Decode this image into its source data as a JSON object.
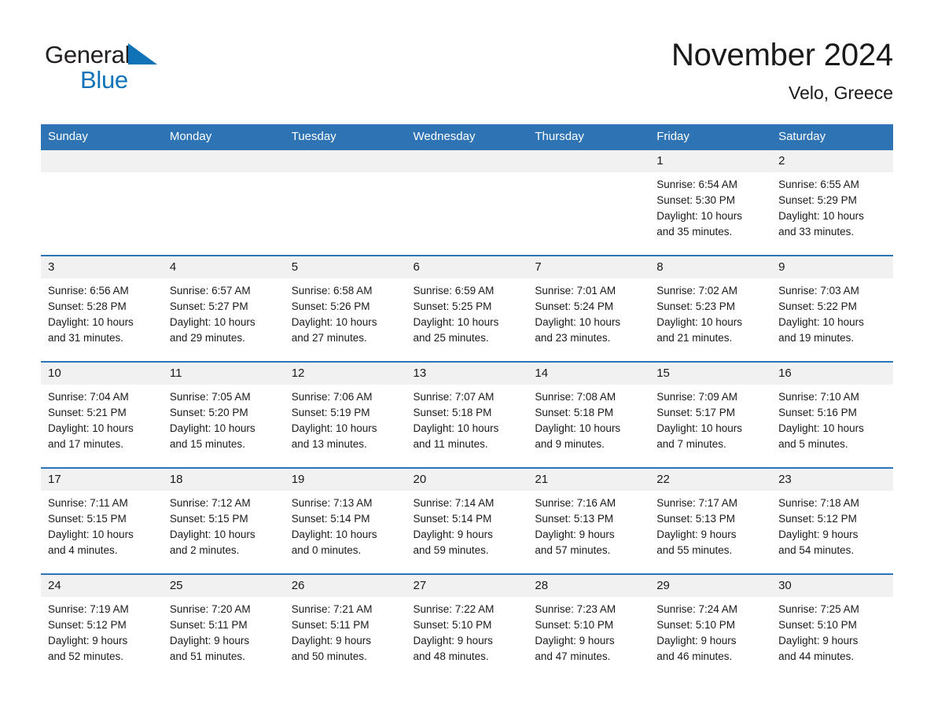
{
  "logo": {
    "word1": "General",
    "word2": "Blue",
    "triangle_color": "#1073b8",
    "text_color": "#231f20"
  },
  "header": {
    "title": "November 2024",
    "subtitle": "Velo, Greece"
  },
  "theme": {
    "header_blue": "#2e74b5",
    "daynum_gray": "#f1f1f1",
    "text": "#1a1a1a"
  },
  "weekday_headers": [
    "Sunday",
    "Monday",
    "Tuesday",
    "Wednesday",
    "Thursday",
    "Friday",
    "Saturday"
  ],
  "weeks": [
    [
      {
        "day": "",
        "sunrise": "",
        "sunset": "",
        "daylight1": "",
        "daylight2": ""
      },
      {
        "day": "",
        "sunrise": "",
        "sunset": "",
        "daylight1": "",
        "daylight2": ""
      },
      {
        "day": "",
        "sunrise": "",
        "sunset": "",
        "daylight1": "",
        "daylight2": ""
      },
      {
        "day": "",
        "sunrise": "",
        "sunset": "",
        "daylight1": "",
        "daylight2": ""
      },
      {
        "day": "",
        "sunrise": "",
        "sunset": "",
        "daylight1": "",
        "daylight2": ""
      },
      {
        "day": "1",
        "sunrise": "Sunrise: 6:54 AM",
        "sunset": "Sunset: 5:30 PM",
        "daylight1": "Daylight: 10 hours",
        "daylight2": "and 35 minutes."
      },
      {
        "day": "2",
        "sunrise": "Sunrise: 6:55 AM",
        "sunset": "Sunset: 5:29 PM",
        "daylight1": "Daylight: 10 hours",
        "daylight2": "and 33 minutes."
      }
    ],
    [
      {
        "day": "3",
        "sunrise": "Sunrise: 6:56 AM",
        "sunset": "Sunset: 5:28 PM",
        "daylight1": "Daylight: 10 hours",
        "daylight2": "and 31 minutes."
      },
      {
        "day": "4",
        "sunrise": "Sunrise: 6:57 AM",
        "sunset": "Sunset: 5:27 PM",
        "daylight1": "Daylight: 10 hours",
        "daylight2": "and 29 minutes."
      },
      {
        "day": "5",
        "sunrise": "Sunrise: 6:58 AM",
        "sunset": "Sunset: 5:26 PM",
        "daylight1": "Daylight: 10 hours",
        "daylight2": "and 27 minutes."
      },
      {
        "day": "6",
        "sunrise": "Sunrise: 6:59 AM",
        "sunset": "Sunset: 5:25 PM",
        "daylight1": "Daylight: 10 hours",
        "daylight2": "and 25 minutes."
      },
      {
        "day": "7",
        "sunrise": "Sunrise: 7:01 AM",
        "sunset": "Sunset: 5:24 PM",
        "daylight1": "Daylight: 10 hours",
        "daylight2": "and 23 minutes."
      },
      {
        "day": "8",
        "sunrise": "Sunrise: 7:02 AM",
        "sunset": "Sunset: 5:23 PM",
        "daylight1": "Daylight: 10 hours",
        "daylight2": "and 21 minutes."
      },
      {
        "day": "9",
        "sunrise": "Sunrise: 7:03 AM",
        "sunset": "Sunset: 5:22 PM",
        "daylight1": "Daylight: 10 hours",
        "daylight2": "and 19 minutes."
      }
    ],
    [
      {
        "day": "10",
        "sunrise": "Sunrise: 7:04 AM",
        "sunset": "Sunset: 5:21 PM",
        "daylight1": "Daylight: 10 hours",
        "daylight2": "and 17 minutes."
      },
      {
        "day": "11",
        "sunrise": "Sunrise: 7:05 AM",
        "sunset": "Sunset: 5:20 PM",
        "daylight1": "Daylight: 10 hours",
        "daylight2": "and 15 minutes."
      },
      {
        "day": "12",
        "sunrise": "Sunrise: 7:06 AM",
        "sunset": "Sunset: 5:19 PM",
        "daylight1": "Daylight: 10 hours",
        "daylight2": "and 13 minutes."
      },
      {
        "day": "13",
        "sunrise": "Sunrise: 7:07 AM",
        "sunset": "Sunset: 5:18 PM",
        "daylight1": "Daylight: 10 hours",
        "daylight2": "and 11 minutes."
      },
      {
        "day": "14",
        "sunrise": "Sunrise: 7:08 AM",
        "sunset": "Sunset: 5:18 PM",
        "daylight1": "Daylight: 10 hours",
        "daylight2": "and 9 minutes."
      },
      {
        "day": "15",
        "sunrise": "Sunrise: 7:09 AM",
        "sunset": "Sunset: 5:17 PM",
        "daylight1": "Daylight: 10 hours",
        "daylight2": "and 7 minutes."
      },
      {
        "day": "16",
        "sunrise": "Sunrise: 7:10 AM",
        "sunset": "Sunset: 5:16 PM",
        "daylight1": "Daylight: 10 hours",
        "daylight2": "and 5 minutes."
      }
    ],
    [
      {
        "day": "17",
        "sunrise": "Sunrise: 7:11 AM",
        "sunset": "Sunset: 5:15 PM",
        "daylight1": "Daylight: 10 hours",
        "daylight2": "and 4 minutes."
      },
      {
        "day": "18",
        "sunrise": "Sunrise: 7:12 AM",
        "sunset": "Sunset: 5:15 PM",
        "daylight1": "Daylight: 10 hours",
        "daylight2": "and 2 minutes."
      },
      {
        "day": "19",
        "sunrise": "Sunrise: 7:13 AM",
        "sunset": "Sunset: 5:14 PM",
        "daylight1": "Daylight: 10 hours",
        "daylight2": "and 0 minutes."
      },
      {
        "day": "20",
        "sunrise": "Sunrise: 7:14 AM",
        "sunset": "Sunset: 5:14 PM",
        "daylight1": "Daylight: 9 hours",
        "daylight2": "and 59 minutes."
      },
      {
        "day": "21",
        "sunrise": "Sunrise: 7:16 AM",
        "sunset": "Sunset: 5:13 PM",
        "daylight1": "Daylight: 9 hours",
        "daylight2": "and 57 minutes."
      },
      {
        "day": "22",
        "sunrise": "Sunrise: 7:17 AM",
        "sunset": "Sunset: 5:13 PM",
        "daylight1": "Daylight: 9 hours",
        "daylight2": "and 55 minutes."
      },
      {
        "day": "23",
        "sunrise": "Sunrise: 7:18 AM",
        "sunset": "Sunset: 5:12 PM",
        "daylight1": "Daylight: 9 hours",
        "daylight2": "and 54 minutes."
      }
    ],
    [
      {
        "day": "24",
        "sunrise": "Sunrise: 7:19 AM",
        "sunset": "Sunset: 5:12 PM",
        "daylight1": "Daylight: 9 hours",
        "daylight2": "and 52 minutes."
      },
      {
        "day": "25",
        "sunrise": "Sunrise: 7:20 AM",
        "sunset": "Sunset: 5:11 PM",
        "daylight1": "Daylight: 9 hours",
        "daylight2": "and 51 minutes."
      },
      {
        "day": "26",
        "sunrise": "Sunrise: 7:21 AM",
        "sunset": "Sunset: 5:11 PM",
        "daylight1": "Daylight: 9 hours",
        "daylight2": "and 50 minutes."
      },
      {
        "day": "27",
        "sunrise": "Sunrise: 7:22 AM",
        "sunset": "Sunset: 5:10 PM",
        "daylight1": "Daylight: 9 hours",
        "daylight2": "and 48 minutes."
      },
      {
        "day": "28",
        "sunrise": "Sunrise: 7:23 AM",
        "sunset": "Sunset: 5:10 PM",
        "daylight1": "Daylight: 9 hours",
        "daylight2": "and 47 minutes."
      },
      {
        "day": "29",
        "sunrise": "Sunrise: 7:24 AM",
        "sunset": "Sunset: 5:10 PM",
        "daylight1": "Daylight: 9 hours",
        "daylight2": "and 46 minutes."
      },
      {
        "day": "30",
        "sunrise": "Sunrise: 7:25 AM",
        "sunset": "Sunset: 5:10 PM",
        "daylight1": "Daylight: 9 hours",
        "daylight2": "and 44 minutes."
      }
    ]
  ]
}
